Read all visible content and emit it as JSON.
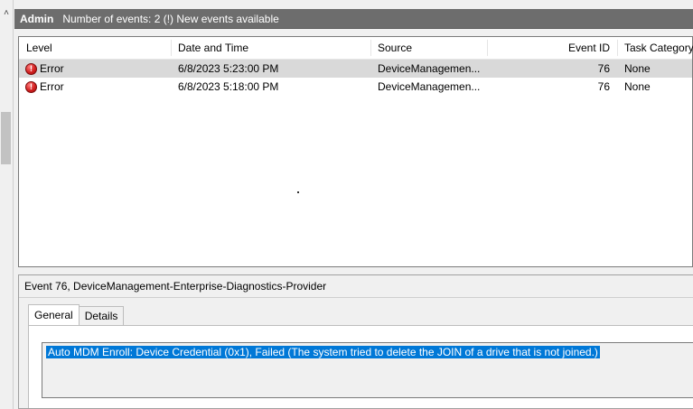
{
  "header": {
    "log_name": "Admin",
    "summary": "Number of events: 2 (!) New events available"
  },
  "columns": {
    "level": "Level",
    "date_time": "Date and Time",
    "source": "Source",
    "event_id": "Event ID",
    "task_category": "Task Category"
  },
  "events": [
    {
      "level": "Error",
      "date_time": "6/8/2023 5:23:00 PM",
      "source": "DeviceManagemen...",
      "event_id": "76",
      "task_category": "None"
    },
    {
      "level": "Error",
      "date_time": "6/8/2023 5:18:00 PM",
      "source": "DeviceManagemen...",
      "event_id": "76",
      "task_category": "None"
    }
  ],
  "details": {
    "title": "Event 76, DeviceManagement-Enterprise-Diagnostics-Provider",
    "tabs": [
      "General",
      "Details"
    ],
    "description": "Auto MDM Enroll: Device Credential (0x1), Failed (The system tried to delete the JOIN of a drive that is not joined.)"
  },
  "icons": {
    "error": "error-icon",
    "scroll_up": "chevron-up-icon"
  },
  "colors": {
    "header_bg": "#6d6d6d",
    "selection": "#0078d7",
    "error": "#d32020"
  }
}
